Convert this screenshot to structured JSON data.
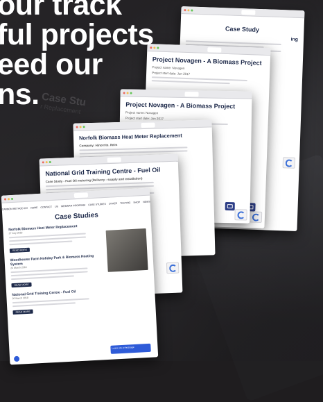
{
  "headline": {
    "lines": [
      "our track",
      "ful projects",
      "eed our",
      "ns."
    ]
  },
  "background": {
    "ghost_title": "Case Stu",
    "ghost_sub": "r Replacement"
  },
  "windows": {
    "back": {
      "title": "Case Study",
      "side_text": "ing"
    },
    "novagen_a": {
      "title": "Project Novagen - A Biomass Project",
      "meta1": "Project name: Novagen",
      "meta2": "Project start date: Jun 2017"
    },
    "novagen_b": {
      "title": "Project Novagen - A Biomass Project",
      "meta1": "Project name: Novagen",
      "meta2": "Project start date: Jun 2017"
    },
    "norfolk": {
      "title": "Norfolk Biomass Heat Meter Replacement",
      "meta1": "Company: Hinorrite. Ifelm"
    },
    "grid": {
      "title": "National Grid Training Centre - Fuel Oil",
      "meta1": "Case Study - Fuel Oil metering (Delivery - supply and installation)"
    },
    "front": {
      "nav": [
        "CARBON METHOD CO",
        "HOME",
        "CONTACT",
        "US",
        "WEBINAR PROGRAM",
        "CASE STUDIES",
        "OTHER",
        "TESTING",
        "SHOP",
        "NEWS"
      ],
      "heading": "Case Studies",
      "cases": [
        {
          "title": "Norfolk Biomass Heat Meter Replacement",
          "date": "27 July 2018"
        },
        {
          "title": "Woodhouse Farm Holiday Park & Biomass Heating System",
          "date": "24 March 2018"
        },
        {
          "title": "National Grid Training Centre - Fuel Oil",
          "date": "20 March 2018"
        }
      ],
      "read_more": "READ MORE",
      "chat_label": "Leave us a message"
    }
  }
}
